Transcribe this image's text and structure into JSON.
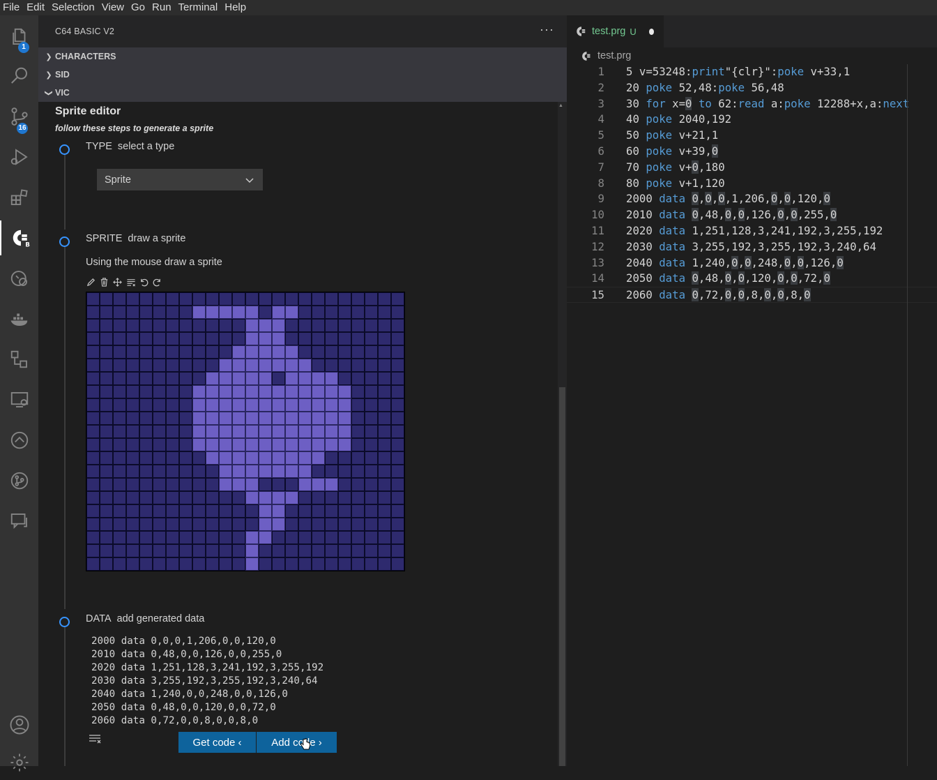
{
  "menu": [
    "File",
    "Edit",
    "Selection",
    "View",
    "Go",
    "Run",
    "Terminal",
    "Help"
  ],
  "activity": {
    "explorer_badge": "1",
    "scm_badge": "16"
  },
  "sidebar": {
    "title": "C64 BASIC V2",
    "more": "···",
    "sections": [
      "CHARACTERS",
      "SID",
      "VIC"
    ]
  },
  "sprite_editor": {
    "title": "Sprite editor",
    "subtitle": "follow these steps to generate a sprite",
    "steps": [
      {
        "name": "TYPE",
        "text": "select a type"
      },
      {
        "name": "SPRITE",
        "text": "draw a sprite"
      },
      {
        "name": "DATA",
        "text": "add generated data"
      }
    ],
    "type_select_value": "Sprite",
    "instruction": "Using the mouse draw a sprite",
    "sprite_rows": [
      "000000000000000000000000",
      "000000001111101100000000",
      "000000000000111000000000",
      "000000000000111000000000",
      "000000000001111100000000",
      "000000000011111110000000",
      "000000000111110111100000",
      "000000001111111111110000",
      "000000001111111111110000",
      "000000001111111111110000",
      "000000001111111111110000",
      "000000001111111111110000",
      "000000000111111111000000",
      "000000000011111110000000",
      "000000000011100011100000",
      "000000000000111100000000",
      "000000000000011000000000",
      "000000000000011000000000",
      "000000000000110000000000",
      "000000000000100000000000",
      "000000000000100000000000"
    ],
    "data_lines": [
      "2000 data 0,0,0,1,206,0,0,120,0",
      "2010 data 0,48,0,0,126,0,0,255,0",
      "2020 data 1,251,128,3,241,192,3,255,192",
      "2030 data 3,255,192,3,255,192,3,240,64",
      "2040 data 1,240,0,0,248,0,0,126,0",
      "2050 data 0,48,0,0,120,0,0,72,0",
      "2060 data 0,72,0,0,8,0,0,8,0"
    ],
    "get_code": "Get code ‹",
    "add_code": "Add code ›"
  },
  "editor": {
    "tab_name": "test.prg",
    "tab_status": "U",
    "breadcrumb": "test.prg",
    "lines": [
      {
        "num": "1",
        "html": "5 v=53248:<span class='kw'>print</span>\"{clr}\":<span class='kw'>poke</span> v+33,1"
      },
      {
        "num": "2",
        "html": "20 <span class='kw'>poke</span> 52,48:<span class='kw'>poke</span> 56,48"
      },
      {
        "num": "3",
        "html": "30 <span class='kw'>for</span> x=<span class='hl0'>0</span> <span class='kw'>to</span> 62:<span class='kw'>read</span> a:<span class='kw'>poke</span> 12288+x,a:<span class='kw'>next</span>"
      },
      {
        "num": "4",
        "html": "40 <span class='kw'>poke</span> 2040,192"
      },
      {
        "num": "5",
        "html": "50 <span class='kw'>poke</span> v+21,1"
      },
      {
        "num": "6",
        "html": "60 <span class='kw'>poke</span> v+39,<span class='hl0'>0</span>"
      },
      {
        "num": "7",
        "html": "70 <span class='kw'>poke</span> v+<span class='hl0'>0</span>,180"
      },
      {
        "num": "8",
        "html": "80 <span class='kw'>poke</span> v+1,120"
      },
      {
        "num": "9",
        "html": "2000 <span class='kw'>data</span> <span class='hl0'>0</span>,<span class='hl0'>0</span>,<span class='hl0'>0</span>,1,206,<span class='hl0'>0</span>,<span class='hl0'>0</span>,120,<span class='hl0'>0</span>"
      },
      {
        "num": "10",
        "html": "2010 <span class='kw'>data</span> <span class='hl0'>0</span>,48,<span class='hl0'>0</span>,<span class='hl0'>0</span>,126,<span class='hl0'>0</span>,<span class='hl0'>0</span>,255,<span class='hl0'>0</span>"
      },
      {
        "num": "11",
        "html": "2020 <span class='kw'>data</span> 1,251,128,3,241,192,3,255,192"
      },
      {
        "num": "12",
        "html": "2030 <span class='kw'>data</span> 3,255,192,3,255,192,3,240,64"
      },
      {
        "num": "13",
        "html": "2040 <span class='kw'>data</span> 1,240,<span class='hl0'>0</span>,<span class='hl0'>0</span>,248,<span class='hl0'>0</span>,<span class='hl0'>0</span>,126,<span class='hl0'>0</span>"
      },
      {
        "num": "14",
        "html": "2050 <span class='kw'>data</span> <span class='hl0'>0</span>,48,<span class='hl0'>0</span>,<span class='hl0'>0</span>,120,<span class='hl0'>0</span>,<span class='hl0'>0</span>,72,<span class='hl0'>0</span>"
      },
      {
        "num": "15",
        "html": "2060 <span class='kw'>data</span> <span class='hl0'>0</span>,72,<span class='hl0'>0</span>,<span class='hl0'>0</span>,8,<span class='hl0'>0</span>,<span class='hl0'>0</span>,8,<span class='hl0'>0</span>"
      }
    ]
  },
  "colors": {
    "accent": "#3794ff",
    "button": "#0e639c",
    "sprite_off": "#2e2a6e",
    "sprite_on": "#6d5fc4",
    "keyword": "#569cd6",
    "untracked": "#73c991"
  }
}
